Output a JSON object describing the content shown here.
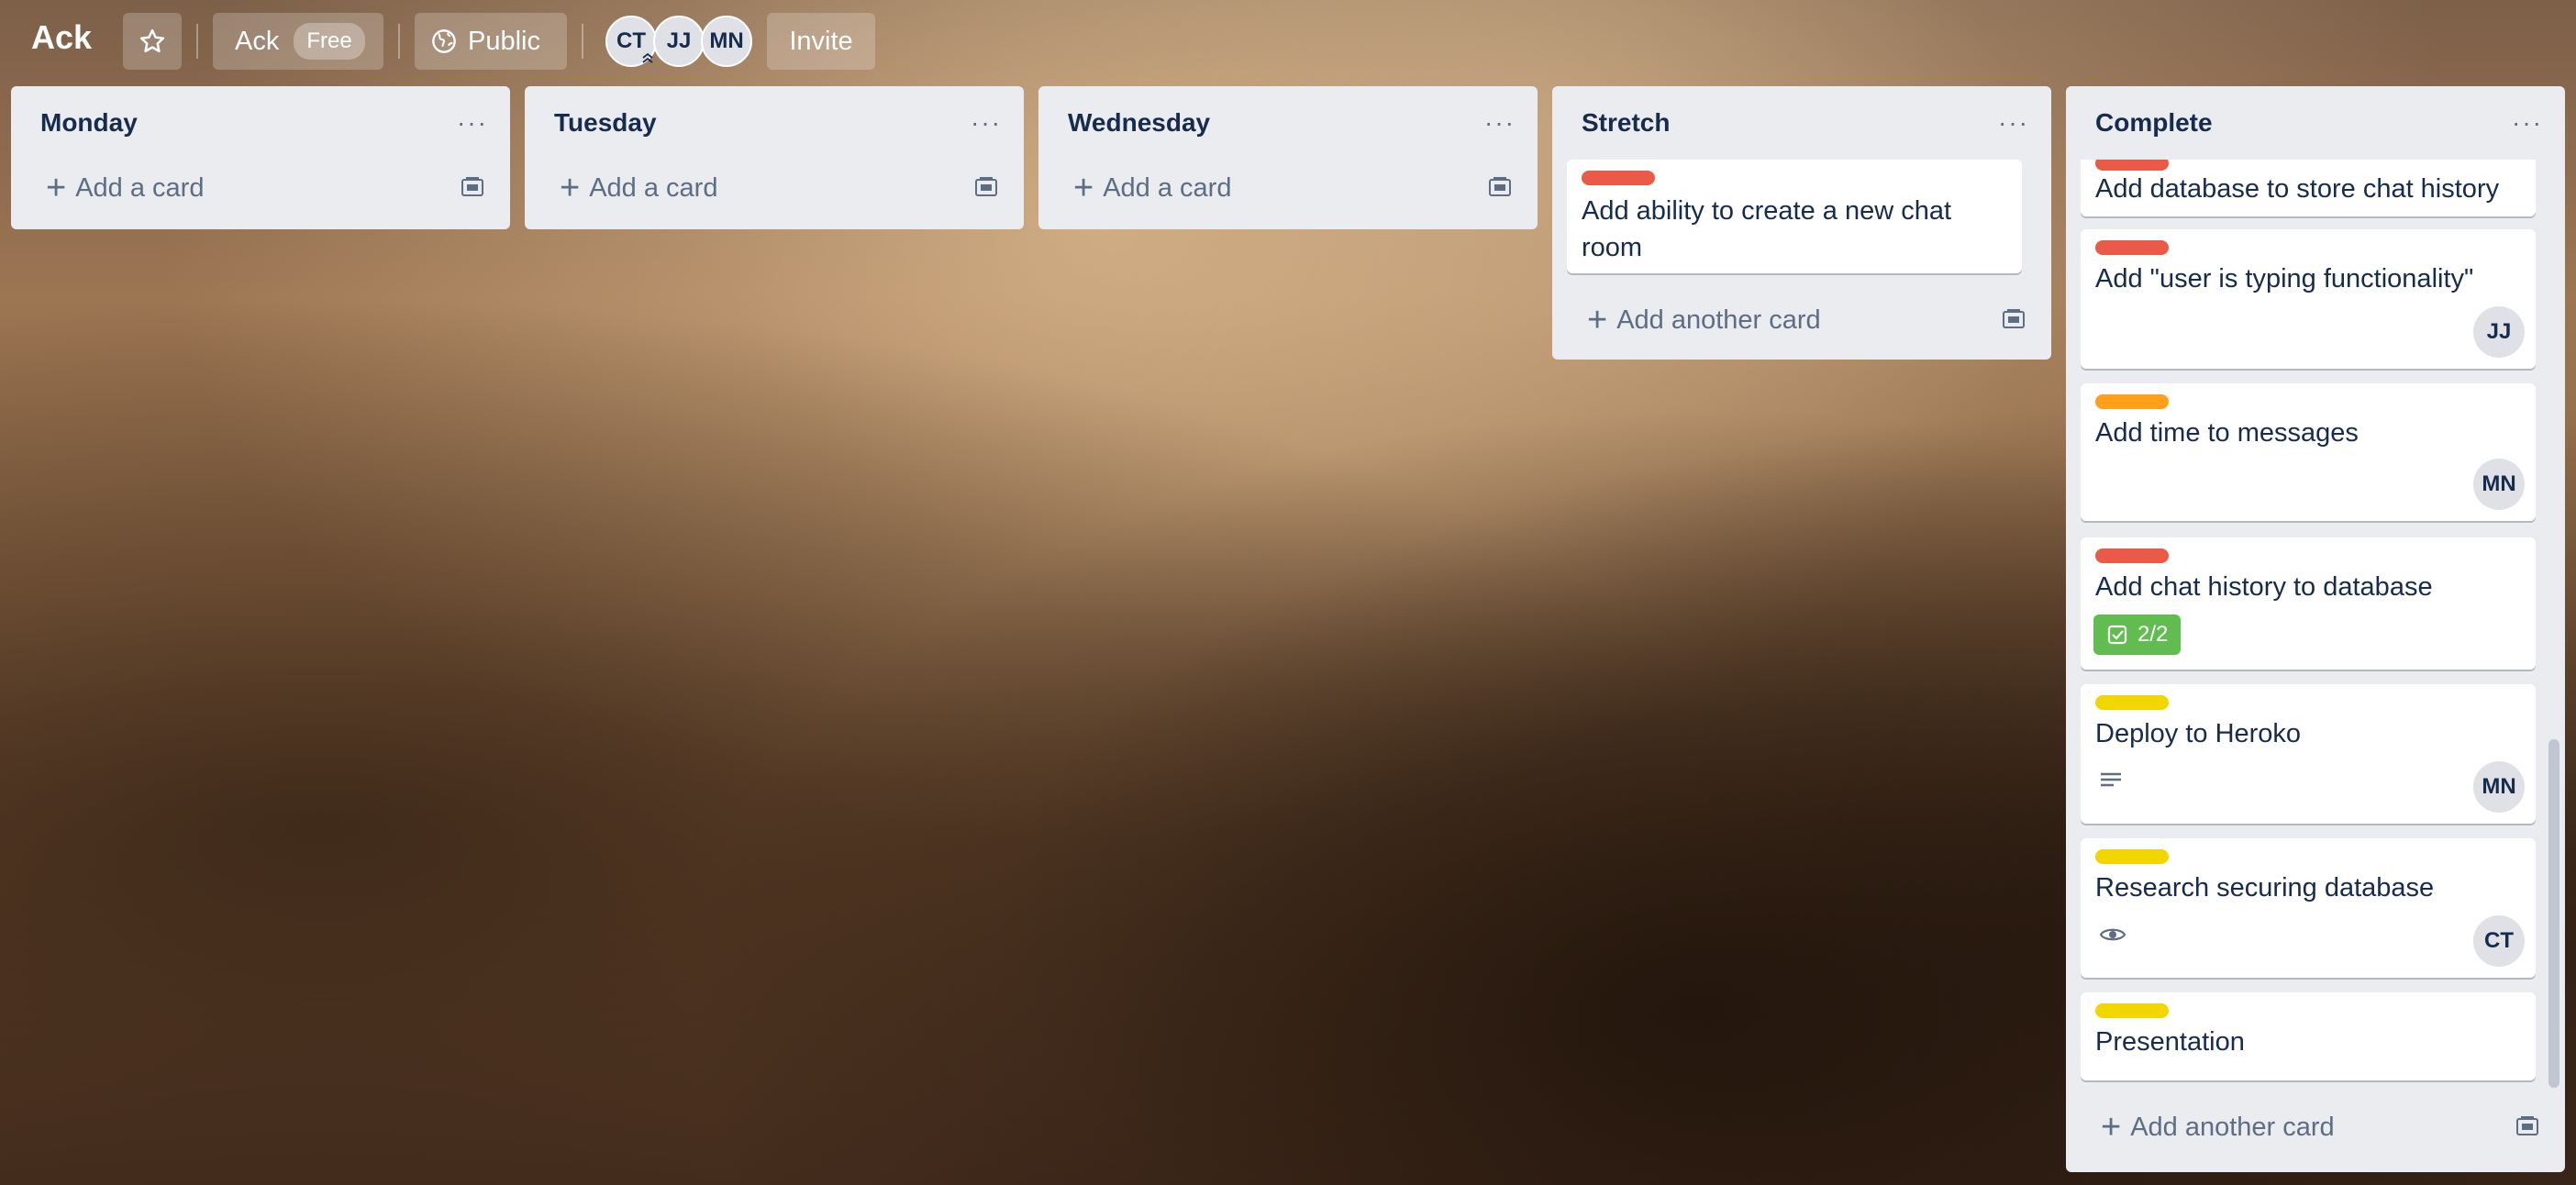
{
  "board": {
    "title": "Ack",
    "workspace_name": "Ack",
    "workspace_plan": "Free",
    "visibility": "Public",
    "invite_label": "Invite",
    "members": [
      "CT",
      "JJ",
      "MN"
    ]
  },
  "lists": [
    {
      "title": "Monday",
      "menu": "···",
      "add_label": "Add a card"
    },
    {
      "title": "Tuesday",
      "menu": "···",
      "add_label": "Add a card"
    },
    {
      "title": "Wednesday",
      "menu": "···",
      "add_label": "Add a card"
    },
    {
      "title": "Stretch",
      "menu": "···",
      "add_label": "Add another card",
      "cards": [
        {
          "text": "Add ability to create a new chat room",
          "label_color": "#eb5a46"
        }
      ]
    },
    {
      "title": "Complete",
      "menu": "···",
      "add_label": "Add another card",
      "cards": [
        {
          "text": "Add database to store chat history",
          "label_color": "#eb5a46"
        },
        {
          "text": "Add \"user is typing functionality\"",
          "label_color": "#eb5a46",
          "member": "JJ"
        },
        {
          "text": "Add time to messages",
          "label_color": "#ff9f1a",
          "member": "MN"
        },
        {
          "text": "Add chat history to database",
          "label_color": "#eb5a46",
          "checklist": "2/2"
        },
        {
          "text": "Deploy to Heroko",
          "label_color": "#f2d600",
          "member": "MN",
          "badge_icon": "description-icon"
        },
        {
          "text": "Research securing database",
          "label_color": "#f2d600",
          "member": "CT",
          "badge_icon": "watch-icon"
        },
        {
          "text": "Presentation",
          "label_color": "#f2d600"
        }
      ]
    }
  ],
  "colors": {
    "checklist_complete": "#61bd4f",
    "list_bg": "#ebecf0"
  }
}
